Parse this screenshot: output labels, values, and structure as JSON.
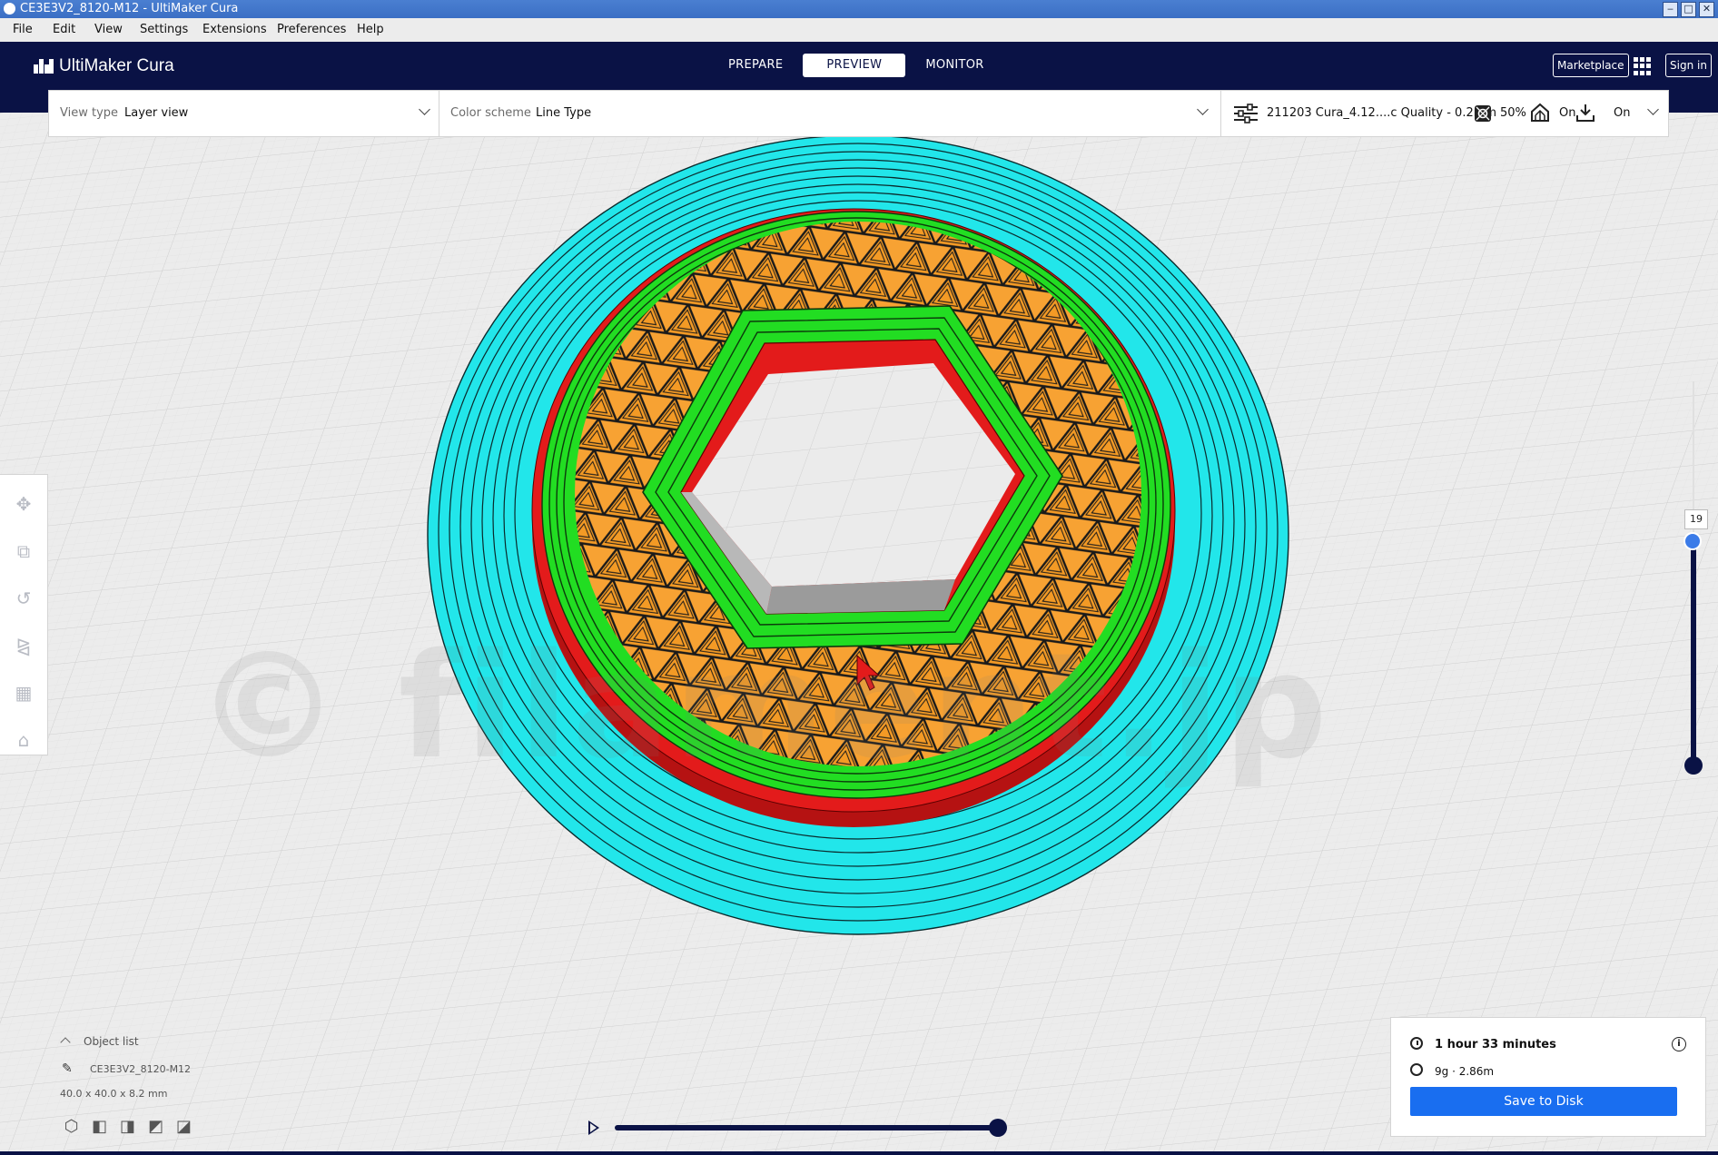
{
  "window": {
    "title": "CE3E3V2_8120-M12 - UltiMaker Cura"
  },
  "menu": [
    "File",
    "Edit",
    "View",
    "Settings",
    "Extensions",
    "Preferences",
    "Help"
  ],
  "header": {
    "logo": "UltiMaker Cura",
    "stages": [
      "PREPARE",
      "PREVIEW",
      "MONITOR"
    ],
    "active_stage": "PREVIEW",
    "marketplace": "Marketplace",
    "signin": "Sign in"
  },
  "toolbar": {
    "view_type_label": "View type",
    "view_type_value": "Layer view",
    "color_scheme_label": "Color scheme",
    "color_scheme_value": "Line Type",
    "profile_name": "211203 Cura_4.12....c Quality - 0.2mm",
    "infill": "50%",
    "support": "On",
    "adhesion": "On"
  },
  "watermark": "© filament.jp",
  "layer_slider": {
    "current_layer": "19",
    "fraction": 0.42
  },
  "object_list": {
    "title": "Object list",
    "object_name": "CE3E3V2_8120-M12",
    "dimensions": "40.0 x 40.0 x 8.2 mm"
  },
  "playback": {
    "progress": 1.0
  },
  "print_info": {
    "time": "1 hour 33 minutes",
    "material": "9g · 2.86m",
    "save_label": "Save to Disk"
  },
  "colors": {
    "header": "#0a1245",
    "accent": "#196ef0",
    "skirt": "#22e6ea",
    "wall_outer": "#e31b1b",
    "wall_inner": "#22dd22",
    "infill": "#f7a233"
  }
}
